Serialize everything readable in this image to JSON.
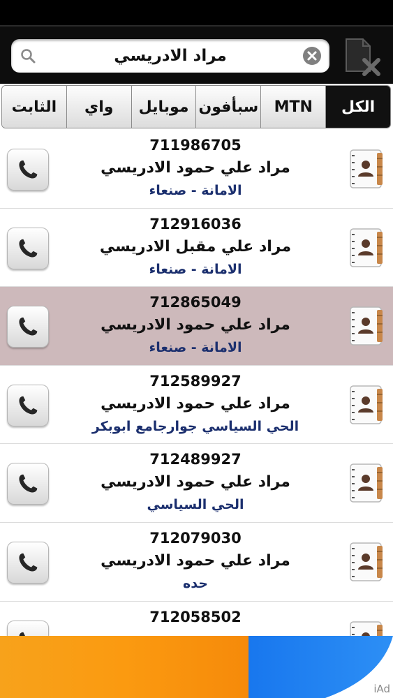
{
  "search": {
    "value": "مراد الادريسي",
    "placeholder": ""
  },
  "tabs": [
    {
      "label": "الكل",
      "active": true
    },
    {
      "label": "MTN",
      "active": false
    },
    {
      "label": "سبأفون",
      "active": false
    },
    {
      "label": "موبايل",
      "active": false
    },
    {
      "label": "واي",
      "active": false
    },
    {
      "label": "الثابت",
      "active": false
    }
  ],
  "contacts": [
    {
      "phone": "711986705",
      "name": "مراد علي حمود الادريسي",
      "address": "الامانة - صنعاء"
    },
    {
      "phone": "712916036",
      "name": "مراد علي مقبل الادريسي",
      "address": "الامانة - صنعاء"
    },
    {
      "phone": "712865049",
      "name": "مراد علي حمود الادريسي",
      "address": "الامانة - صنعاء"
    },
    {
      "phone": "712589927",
      "name": "مراد علي حمود الادريسي",
      "address": "الحي السياسي جوارجامع ابوبكر"
    },
    {
      "phone": "712489927",
      "name": "مراد علي حمود الادريسي",
      "address": "الحي السياسي"
    },
    {
      "phone": "712079030",
      "name": "مراد علي حمود الادريسي",
      "address": "حده"
    },
    {
      "phone": "712058502",
      "name": "",
      "address": ""
    }
  ],
  "ad": {
    "label": "iAd"
  },
  "colors": {
    "selected_row": "#cdb9bb",
    "address_text": "#1b2f6e",
    "active_tab": "#111111"
  }
}
